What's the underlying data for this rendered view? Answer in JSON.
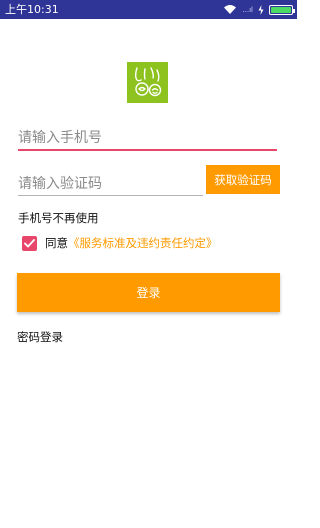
{
  "status_bar": {
    "time": "上午10:31",
    "signal_text": "...ıl",
    "colors": {
      "background": "#2f3596",
      "battery": "#4cd964"
    }
  },
  "logo": {
    "icon": "app-logo-icon",
    "color": "#8dc21f"
  },
  "phone": {
    "placeholder": "请输入手机号"
  },
  "code": {
    "placeholder": "请输入验证码",
    "get_code_label": "获取验证码"
  },
  "phone_unused_label": "手机号不再使用",
  "agreement": {
    "checked": true,
    "prefix": "同意",
    "link": "《服务标准及违约责任约定》"
  },
  "login_label": "登录",
  "password_login_label": "密码登录",
  "colors": {
    "accent": "#ff9a00",
    "highlight": "#e8476b"
  }
}
